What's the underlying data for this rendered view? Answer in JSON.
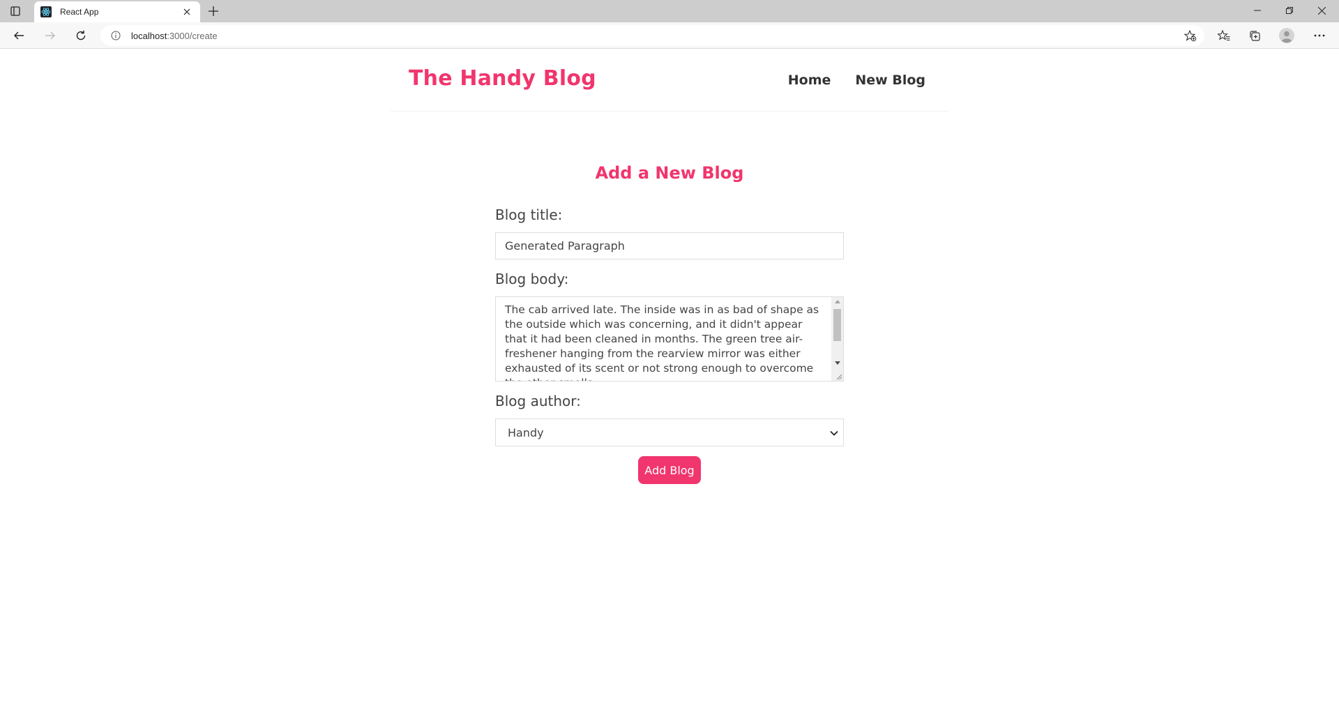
{
  "browser": {
    "tab_title": "React App",
    "url_host": "localhost",
    "url_path": ":3000/create",
    "icons": {
      "tab_actions": "tab-actions-icon",
      "favicon": "react-icon",
      "tab_close": "close-icon",
      "new_tab": "plus-icon",
      "back": "back-arrow-icon",
      "forward": "forward-arrow-icon",
      "refresh": "refresh-icon",
      "site_info": "info-icon",
      "add_favorite": "star-add-icon",
      "favorites": "favorites-icon",
      "collections": "collections-icon",
      "profile": "profile-icon",
      "menu": "more-icon",
      "minimize": "minimize-icon",
      "restore": "restore-icon",
      "close_window": "close-icon"
    }
  },
  "navbar": {
    "brand": "The Handy Blog",
    "links": [
      {
        "label": "Home"
      },
      {
        "label": "New Blog"
      }
    ]
  },
  "create": {
    "title": "Add a New Blog",
    "title_label": "Blog title:",
    "title_value": "Generated Paragraph",
    "body_label": "Blog body:",
    "body_value": "The cab arrived late. The inside was in as bad of shape as the outside which was concerning, and it didn't appear that it had been cleaned in months. The green tree air-freshener hanging from the rearview mirror was either exhausted of its scent or not strong enough to overcome the other smells",
    "author_label": "Blog author:",
    "author_value": "Handy",
    "submit_label": "Add Blog"
  },
  "colors": {
    "accent": "#f1356d",
    "text": "#333333",
    "browser_tabbar": "#cdcdcd"
  }
}
